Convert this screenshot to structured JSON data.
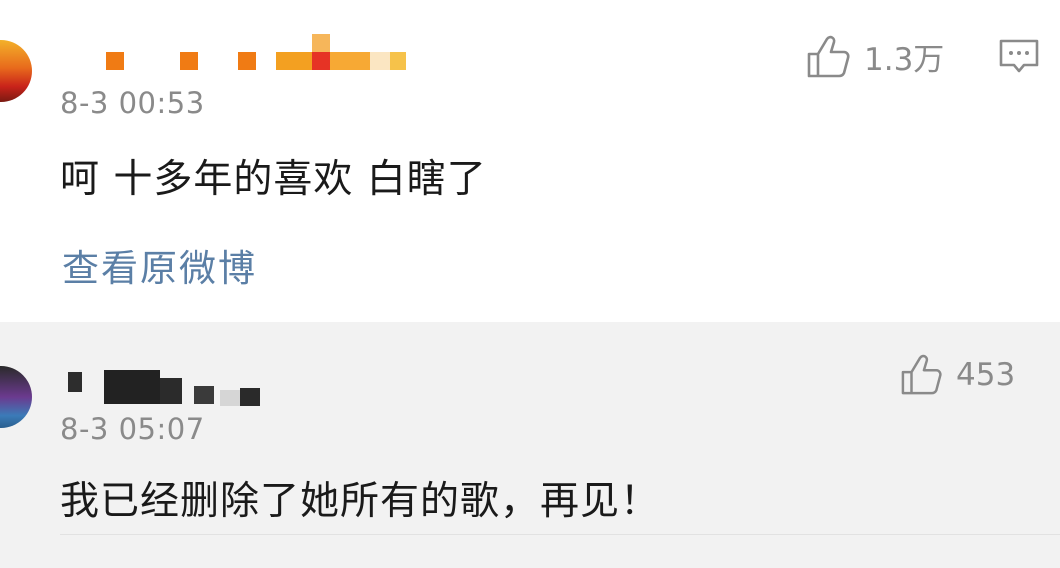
{
  "comments": [
    {
      "time": "8-3 00:53",
      "text": "呵 十多年的喜欢 白瞎了",
      "likes": "1.3万",
      "view_original": "查看原微博"
    },
    {
      "time": "8-3 05:07",
      "text": "我已经删除了她所有的歌，再见！",
      "likes": "453"
    }
  ],
  "icons": {
    "like": "thumbs-up-icon",
    "reply": "comment-bubble-icon"
  },
  "colors": {
    "link": "#5b7fa6",
    "meta": "#8a8a8a",
    "text": "#1a1a1a",
    "card2_bg": "#f2f2f2"
  }
}
